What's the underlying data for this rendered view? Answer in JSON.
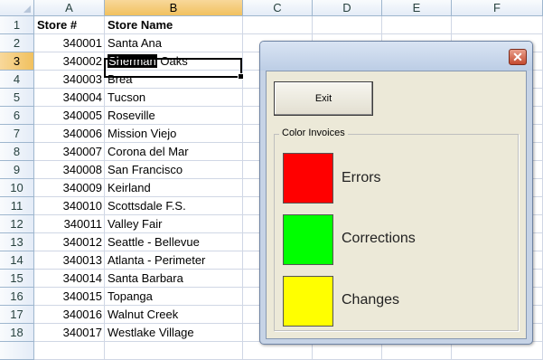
{
  "columns": [
    "A",
    "B",
    "C",
    "D",
    "E",
    "F"
  ],
  "rows": [
    {
      "n": "1",
      "a": "Store #",
      "b": "Store Name"
    },
    {
      "n": "2",
      "a": "340001",
      "b": "Santa Ana"
    },
    {
      "n": "3",
      "a": "340002",
      "b_hl": "Sherman",
      "b_rest": " Oaks"
    },
    {
      "n": "4",
      "a": "340003",
      "b": "Brea"
    },
    {
      "n": "5",
      "a": "340004",
      "b": "Tucson"
    },
    {
      "n": "6",
      "a": "340005",
      "b": "Roseville"
    },
    {
      "n": "7",
      "a": "340006",
      "b": "Mission Viejo"
    },
    {
      "n": "8",
      "a": "340007",
      "b": "Corona del Mar"
    },
    {
      "n": "9",
      "a": "340008",
      "b": "San Francisco"
    },
    {
      "n": "10",
      "a": "340009",
      "b": "Keirland"
    },
    {
      "n": "11",
      "a": "340010",
      "b": "Scottsdale F.S."
    },
    {
      "n": "12",
      "a": "340011",
      "b": "Valley Fair"
    },
    {
      "n": "13",
      "a": "340012",
      "b": "Seattle - Bellevue"
    },
    {
      "n": "14",
      "a": "340013",
      "b": "Atlanta - Perimeter"
    },
    {
      "n": "15",
      "a": "340014",
      "b": "Santa Barbara"
    },
    {
      "n": "16",
      "a": "340015",
      "b": "Topanga"
    },
    {
      "n": "17",
      "a": "340016",
      "b": "Walnut Creek"
    },
    {
      "n": "18",
      "a": "340017",
      "b": "Westlake Village"
    }
  ],
  "dialog": {
    "close_glyph": "✕",
    "exit_label": "Exit",
    "frame_caption": "Color Invoices",
    "swatches": [
      {
        "label": "Errors",
        "color": "#ff0000"
      },
      {
        "label": "Corrections",
        "color": "#00ff00"
      },
      {
        "label": "Changes",
        "color": "#ffff00"
      }
    ]
  },
  "colors": {
    "selected_header": "#f1c15f",
    "grid_line": "#d0d7e5"
  }
}
